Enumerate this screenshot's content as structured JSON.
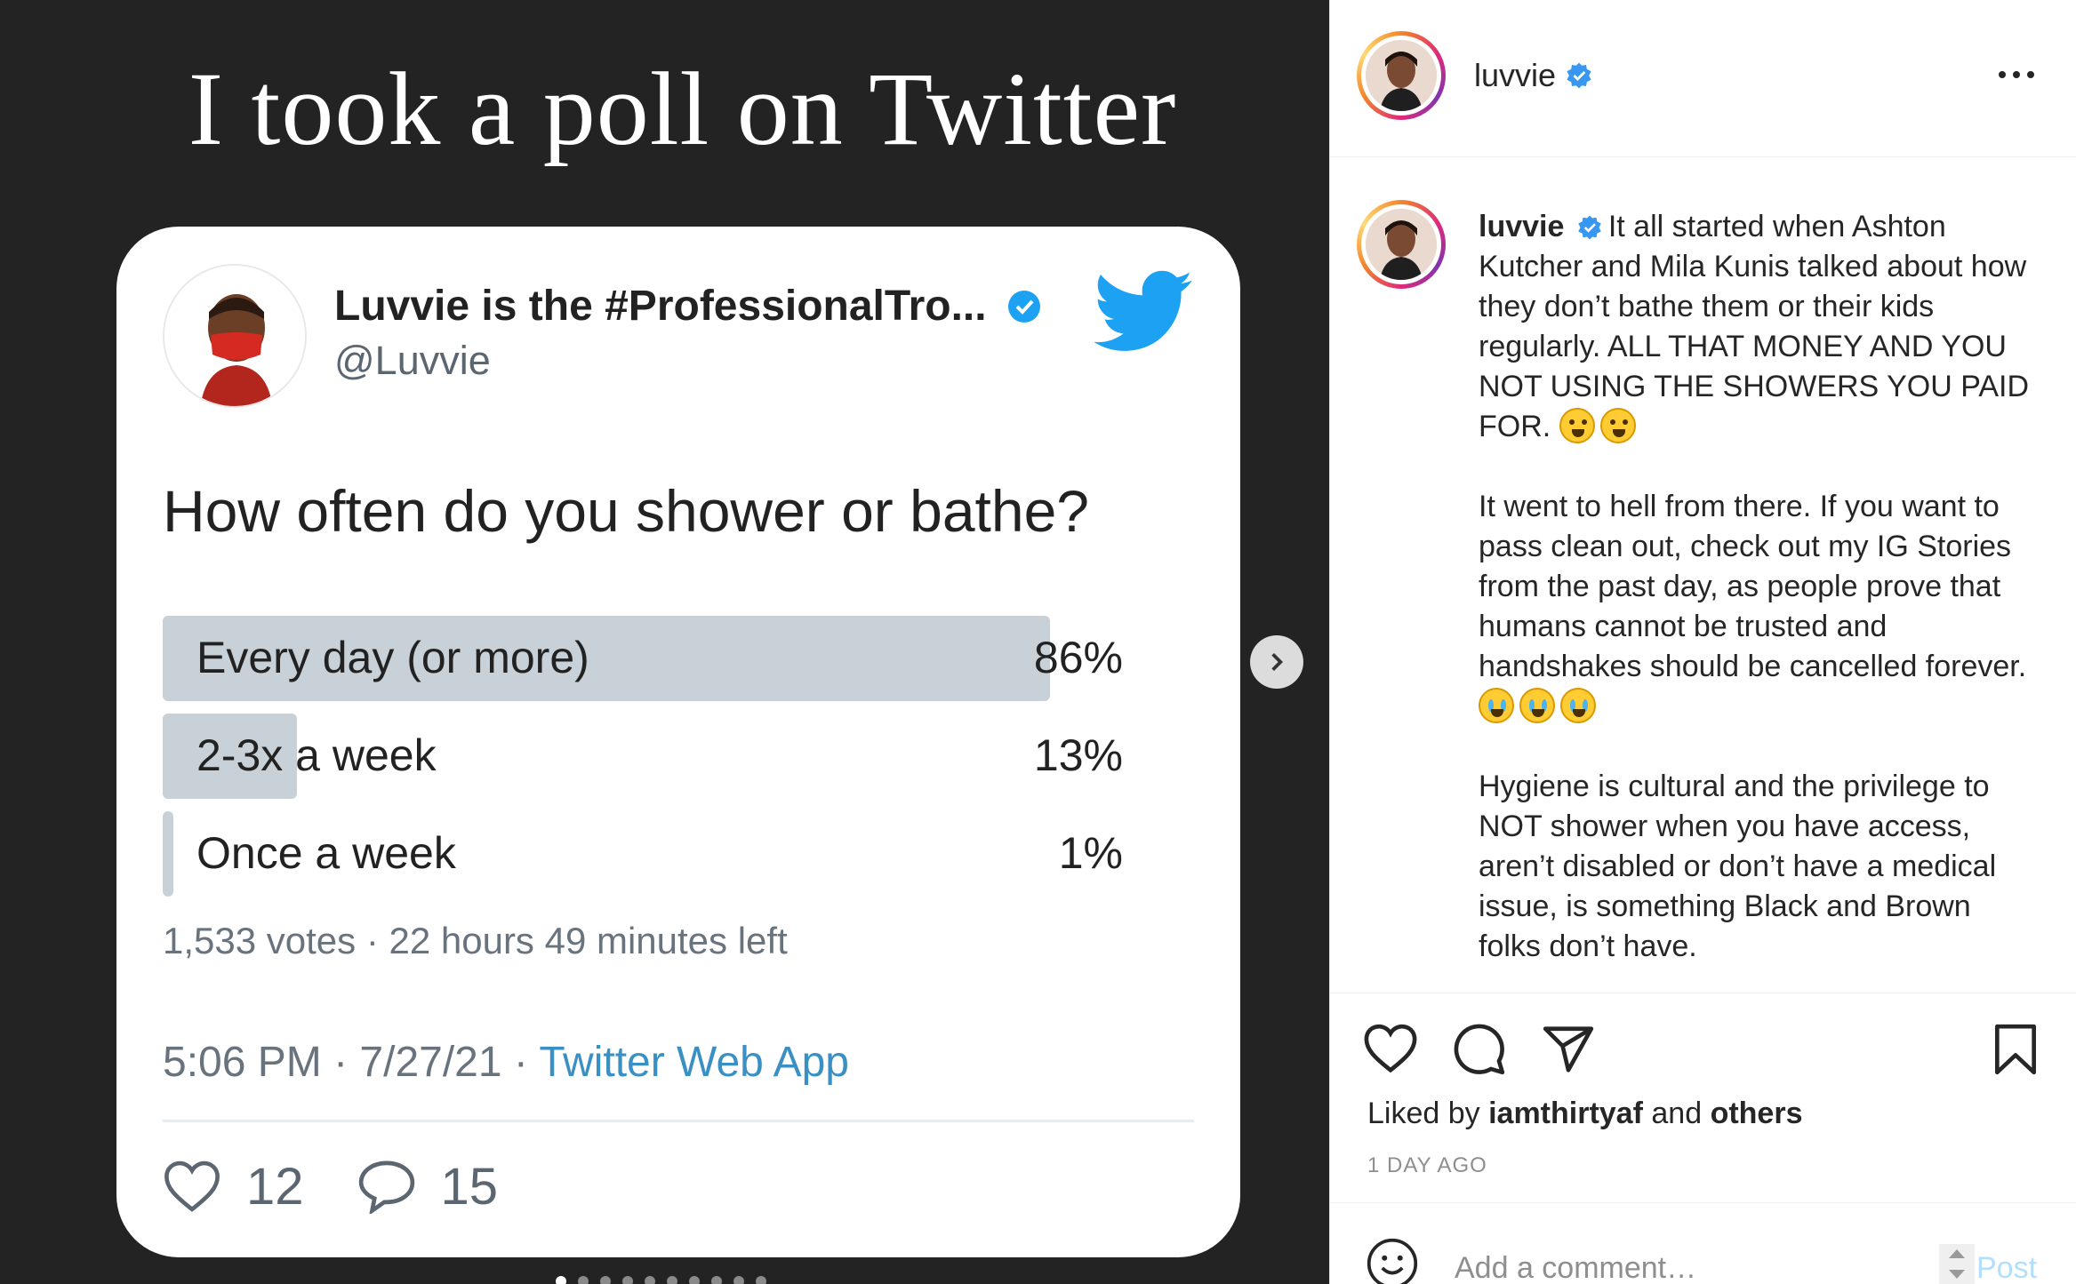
{
  "media": {
    "title": "I took a poll on Twitter",
    "tweet": {
      "author_name": "Luvvie is the #ProfessionalTro...",
      "handle": "@Luvvie",
      "question": "How often do you shower or bathe?",
      "poll": [
        {
          "label": "Every day (or more)",
          "percent_text": "86%",
          "fraction": 0.86
        },
        {
          "label": "2-3x a week",
          "percent_text": "13%",
          "fraction": 0.13
        },
        {
          "label": "Once a week",
          "percent_text": "1%",
          "fraction": 0.01
        }
      ],
      "poll_meta": "1,533 votes · 22 hours 49 minutes left",
      "timestamp": "5:06 PM · 7/27/21 · ",
      "source_app": "Twitter Web App",
      "likes": "12",
      "replies": "15"
    },
    "carousel": {
      "total_slides": 10,
      "active_index": 0
    }
  },
  "post": {
    "username": "luvvie",
    "caption_paragraphs": [
      "It all started when Ashton Kutcher and Mila Kunis talked about how they don’t bathe them or their kids regularly. ALL THAT MONEY AND YOU NOT USING THE SHOWERS YOU PAID FOR.",
      "It went to hell from there. If you want to pass clean out, check out my IG Stories from the past day, as people prove that humans cannot be trusted and handshakes should be cancelled forever.",
      "Hygiene is cultural and the privilege to NOT shower when you have access, aren’t disabled or don’t have a medical issue, is something Black and Brown folks don’t have."
    ],
    "liked_by_prefix": "Liked by",
    "liked_by_user": "iamthirtyaf",
    "liked_by_and": "and",
    "liked_by_others": "others",
    "time_ago": "1 DAY AGO",
    "comment_placeholder": "Add a comment…",
    "post_label": "Post"
  },
  "colors": {
    "media_bg": "#232323",
    "poll_bar": "#c8d1d8",
    "verified_blue": "#3897f0",
    "twitter_blue": "#1da1f2",
    "post_button_disabled": "#b2dffc"
  },
  "icons": [
    "verified-icon",
    "twitter-bird-icon",
    "heart-icon",
    "comment-icon",
    "share-icon",
    "bookmark-icon",
    "more-icon",
    "emoji-icon",
    "chevron-right-icon"
  ]
}
